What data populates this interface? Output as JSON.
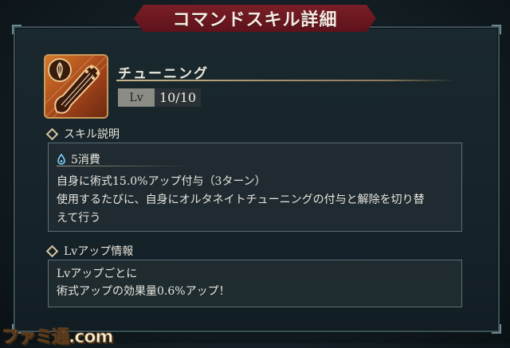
{
  "header": {
    "title": "コマンドスキル詳細"
  },
  "skill": {
    "name": "チューニング",
    "level_label": "Lv",
    "level_value": "10/10",
    "icon": "guitar-icon"
  },
  "description_section": {
    "heading": "スキル説明",
    "cost": "5消費",
    "cost_icon": "mana-drop-icon",
    "lines": [
      "自身に術式15.0%アップ付与（3ターン）",
      "使用するたびに、自身にオルタネイトチューニングの付与と解除を切り替",
      "えて行う"
    ]
  },
  "levelup_section": {
    "heading": "Lvアップ情報",
    "lines": [
      "Lvアップごとに",
      "術式アップの効果量0.6%アップ！"
    ]
  },
  "watermark": "ファミ通.com",
  "colors": {
    "banner": "#6b1820",
    "accent_gold": "#c9b48a",
    "icon_orange": "#d6782c",
    "mana_blue": "#7fd3ff"
  }
}
